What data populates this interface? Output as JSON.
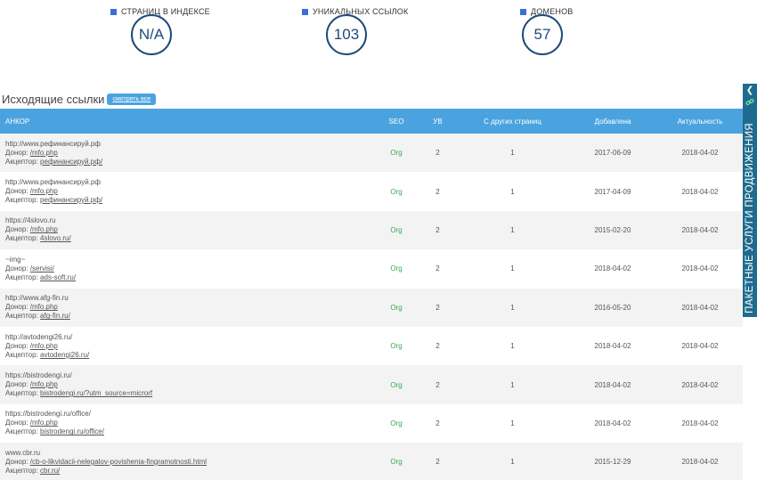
{
  "stats": [
    {
      "label": "СТРАНИЦ В ИНДЕКСЕ",
      "value": "N/A"
    },
    {
      "label": "УНИКАЛЬНЫХ ССЫЛОК",
      "value": "103"
    },
    {
      "label": "ДОМЕНОВ",
      "value": "57"
    }
  ],
  "section": {
    "title": "Исходящие ссылки",
    "view_all": "смотреть все"
  },
  "table": {
    "headers": {
      "anchor": "АНКОР",
      "seo": "SEO",
      "yb": "УВ",
      "other_pages": "С других страниц",
      "added": "Добавлена",
      "actual": "Актуальность"
    },
    "donor_label": "Донор:",
    "acceptor_label": "Акцептор:",
    "rows": [
      {
        "anchor": "http://www.рефинансируй.рф",
        "donor": "/mfo.php",
        "acceptor": "рефинансируй.рф/",
        "seo": "Org",
        "yb": "2",
        "other": "1",
        "added": "2017-06-09",
        "actual": "2018-04-02"
      },
      {
        "anchor": "http://www.рефинансируй.рф",
        "donor": "/mfo.php",
        "acceptor": "рефинансируй.рф/",
        "seo": "Org",
        "yb": "2",
        "other": "1",
        "added": "2017-04-09",
        "actual": "2018-04-02"
      },
      {
        "anchor": "https://4slovo.ru",
        "donor": "/mfo.php",
        "acceptor": "4slovo.ru/",
        "seo": "Org",
        "yb": "2",
        "other": "1",
        "added": "2015-02-20",
        "actual": "2018-04-02"
      },
      {
        "anchor": "~img~",
        "donor": "/servisi/",
        "acceptor": "ads-soft.ru/",
        "seo": "Org",
        "yb": "2",
        "other": "1",
        "added": "2018-04-02",
        "actual": "2018-04-02"
      },
      {
        "anchor": "http://www.afg-fin.ru",
        "donor": "/mfo.php",
        "acceptor": "afg-fin.ru/",
        "seo": "Org",
        "yb": "2",
        "other": "1",
        "added": "2016-05-20",
        "actual": "2018-04-02"
      },
      {
        "anchor": "http://avtodengi26.ru/",
        "donor": "/mfo.php",
        "acceptor": "avtodengi26.ru/",
        "seo": "Org",
        "yb": "2",
        "other": "1",
        "added": "2018-04-02",
        "actual": "2018-04-02"
      },
      {
        "anchor": "https://bistrodengi.ru/",
        "donor": "/mfo.php",
        "acceptor": "bistrodengi.ru/?utm_source=microrf",
        "seo": "Org",
        "yb": "2",
        "other": "1",
        "added": "2018-04-02",
        "actual": "2018-04-02"
      },
      {
        "anchor": "https://bistrodengi.ru/office/",
        "donor": "/mfo.php",
        "acceptor": "bistrodengi.ru/office/",
        "seo": "Org",
        "yb": "2",
        "other": "1",
        "added": "2018-04-02",
        "actual": "2018-04-02"
      },
      {
        "anchor": "www.cbr.ru",
        "donor": "/cb-o-likvidacii-nelegalov-povishenia-fingramotnosti.html",
        "acceptor": "cbr.ru/",
        "seo": "Org",
        "yb": "2",
        "other": "1",
        "added": "2015-12-29",
        "actual": "2018-04-02"
      }
    ]
  },
  "side_tab": {
    "label": "ПАКЕТНЫЕ УСЛУГИ ПРОДВИЖЕНИЯ",
    "arrow_icon": "chevron-left-icon",
    "icon": "link-icon"
  },
  "colors": {
    "header_blue": "#4aa3df",
    "circle_border": "#1d4a7a",
    "seo_green": "#3aa655",
    "side_tab": "#1f6b8f",
    "square_blue": "#3a6fd8"
  }
}
